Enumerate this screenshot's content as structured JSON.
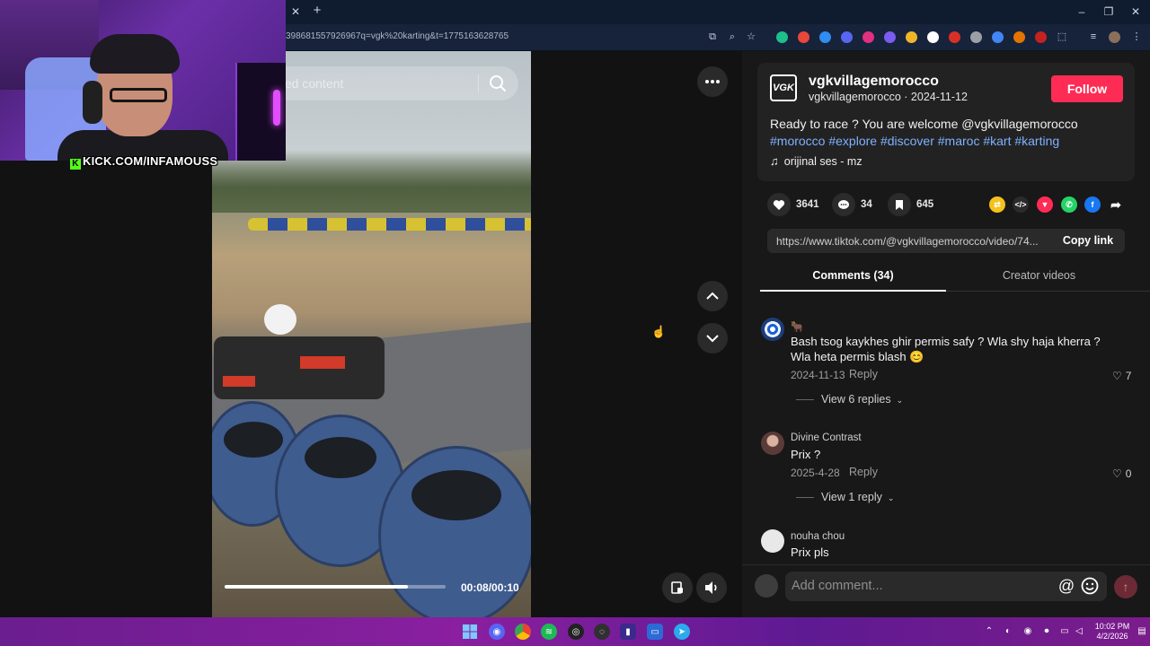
{
  "browser": {
    "url": "398681557926967q=vgk%20karting&t=1775163628765"
  },
  "stream_overlay": {
    "channel_label": "KICK.COM/INFAMOUSS"
  },
  "player": {
    "search_placeholder": "ted content",
    "time": "00:08/00:10",
    "progress": 0.83
  },
  "post": {
    "username": "vgkvillagemorocco",
    "meta": "vgkvillagemorocco · 2024-11-12",
    "follow_label": "Follow",
    "caption": "Ready to race ? You are welcome @vgkvillagemorocco",
    "hashtags": "#morocco #explore #discover #maroc #kart #karting",
    "sound": "orijinal ses - mz",
    "likes": "3641",
    "comments": "34",
    "saves": "645",
    "link": "https://www.tiktok.com/@vgkvillagemorocco/video/74...",
    "copy_label": "Copy link"
  },
  "tabs": {
    "comments": "Comments (34)",
    "creator": "Creator videos"
  },
  "comments": [
    {
      "name": "🐂",
      "text": "Bash tsog kaykhes ghir permis safy ? Wla shy haja kherra ? Wla heta permis blash 😊",
      "date": "2024-11-13",
      "reply_label": "Reply",
      "likes": "7",
      "view_replies": "View 6 replies"
    },
    {
      "name": "Divine Contrast",
      "text": "Prix ?",
      "date": "2025-4-28",
      "reply_label": "Reply",
      "likes": "0",
      "view_replies": "View 1 reply"
    },
    {
      "name": "nouha chou",
      "text": "Prix pls"
    }
  ],
  "comment_box": {
    "placeholder": "Add comment...",
    "at_symbol": "@"
  },
  "taskbar": {
    "time": "10:02 PM",
    "date": "4/2/2026"
  },
  "colors": {
    "accent": "#fe2c55",
    "hashtag": "#7fb1ff",
    "panel_bg": "#181818",
    "kick_green": "#53fc18"
  }
}
